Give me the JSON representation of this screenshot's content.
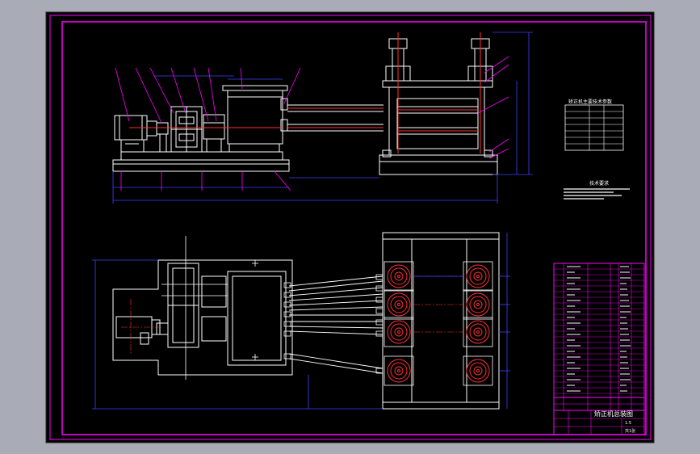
{
  "colors": {
    "viewport_bg": "#a9acb6",
    "sheet_bg": "#000000",
    "border": "#ff00ff",
    "outline": "#ffffff",
    "dimension": "#4040ff",
    "callout": "#ff00ff",
    "thread": "#ff3030",
    "centerline": "#ff3030",
    "grid": "#ffff00"
  },
  "icons": {
    "motor": "motor-icon",
    "roller": "roller-icon",
    "gearbox": "gearbox-icon"
  },
  "title_block": {
    "drawing_title": "矫正机总装图",
    "scale_label": "1:5",
    "sheet_label": "共1张"
  },
  "notes": {
    "tech_params_heading": "矫正机主要技术参数",
    "requirements_heading": "技术要求"
  }
}
